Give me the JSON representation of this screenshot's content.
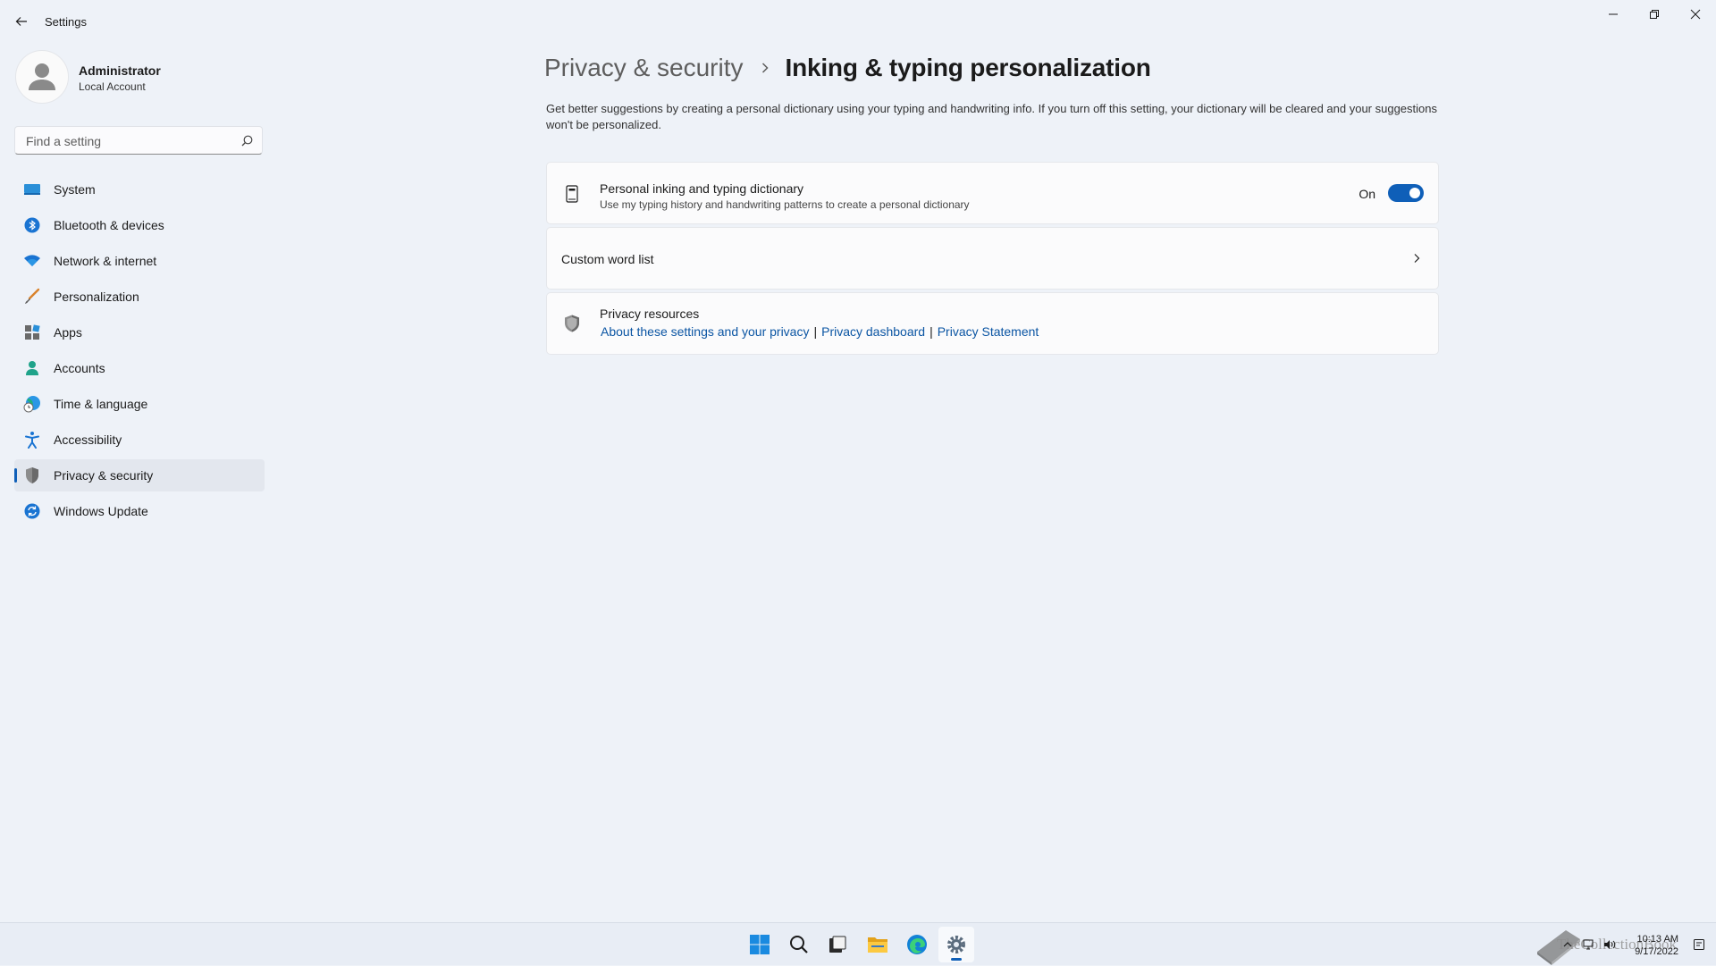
{
  "app": {
    "title": "Settings"
  },
  "profile": {
    "name": "Administrator",
    "account_type": "Local Account"
  },
  "search": {
    "placeholder": "Find a setting"
  },
  "sidebar": {
    "items": [
      {
        "label": "System",
        "icon": "system-icon",
        "active": false
      },
      {
        "label": "Bluetooth & devices",
        "icon": "bluetooth-icon",
        "active": false
      },
      {
        "label": "Network & internet",
        "icon": "wifi-icon",
        "active": false
      },
      {
        "label": "Personalization",
        "icon": "brush-icon",
        "active": false
      },
      {
        "label": "Apps",
        "icon": "apps-icon",
        "active": false
      },
      {
        "label": "Accounts",
        "icon": "person-icon",
        "active": false
      },
      {
        "label": "Time & language",
        "icon": "globe-clock-icon",
        "active": false
      },
      {
        "label": "Accessibility",
        "icon": "accessibility-icon",
        "active": false
      },
      {
        "label": "Privacy & security",
        "icon": "shield-icon",
        "active": true
      },
      {
        "label": "Windows Update",
        "icon": "update-icon",
        "active": false
      }
    ]
  },
  "breadcrumb": {
    "parent": "Privacy & security",
    "current": "Inking & typing personalization"
  },
  "description": "Get better suggestions by creating a personal dictionary using your typing and handwriting info. If you turn off this setting, your dictionary will be cleared and your suggestions won't be personalized.",
  "dictionary_card": {
    "title": "Personal inking and typing dictionary",
    "subtitle": "Use my typing history and handwriting patterns to create a personal dictionary",
    "toggle_state": "On",
    "toggle_on": true
  },
  "custom_word_list": {
    "label": "Custom word list"
  },
  "privacy_resources": {
    "title": "Privacy resources",
    "links": [
      "About these settings and your privacy",
      "Privacy dashboard",
      "Privacy Statement"
    ],
    "separator": "|"
  },
  "taskbar": {
    "apps": [
      "start-icon",
      "search-icon",
      "task-view-icon",
      "file-explorer-icon",
      "edge-icon",
      "settings-icon"
    ],
    "time": "10:13 AM",
    "date": "9/17/2022",
    "watermark": "TheCollectionBook"
  },
  "colors": {
    "accent": "#0f5fb8",
    "link": "#0b55a3",
    "background": "#eef2f8"
  }
}
